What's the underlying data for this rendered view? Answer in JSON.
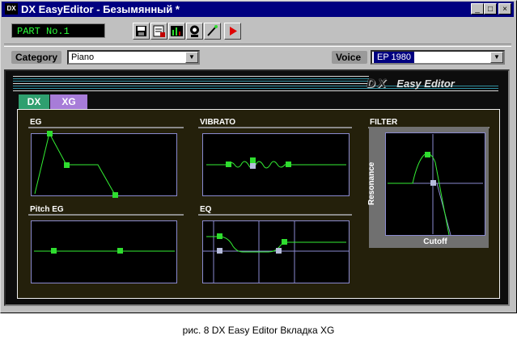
{
  "titlebar": {
    "icon_text": "DX",
    "title": "DX EasyEditor - Безымянный *",
    "buttons": [
      "_",
      "□",
      "×"
    ]
  },
  "toolbar": {
    "part_display": "PART No.1",
    "tool_icons": [
      "save-icon",
      "properties-icon",
      "equalizer-icon",
      "audition-icon",
      "pen-tool-icon",
      "play-icon"
    ]
  },
  "category": {
    "label": "Category",
    "value": "Piano"
  },
  "voice": {
    "label": "Voice",
    "value": "EP 1980"
  },
  "logo": {
    "mark": "DX",
    "text": "Easy Editor"
  },
  "tabs": [
    {
      "label": "DX",
      "color": "#2f9f6f",
      "active": false
    },
    {
      "label": "XG",
      "color": "#a77cd8",
      "active": true
    }
  ],
  "sections": {
    "eg": "EG",
    "vibrato": "VIBRATO",
    "filter": "FILTER",
    "pitch_eg": "Pitch EG",
    "eq": "EQ"
  },
  "filter": {
    "resonance_label": "Resonance",
    "cutoff_label": "Cutoff"
  },
  "colors": {
    "curve": "#33ee33",
    "handle_green": "#2fdd2f",
    "handle_gray": "#b6bcdc",
    "grid_line": "#8a8ad0"
  },
  "caption": "рис. 8  DX Easy Editor Вкладка XG"
}
